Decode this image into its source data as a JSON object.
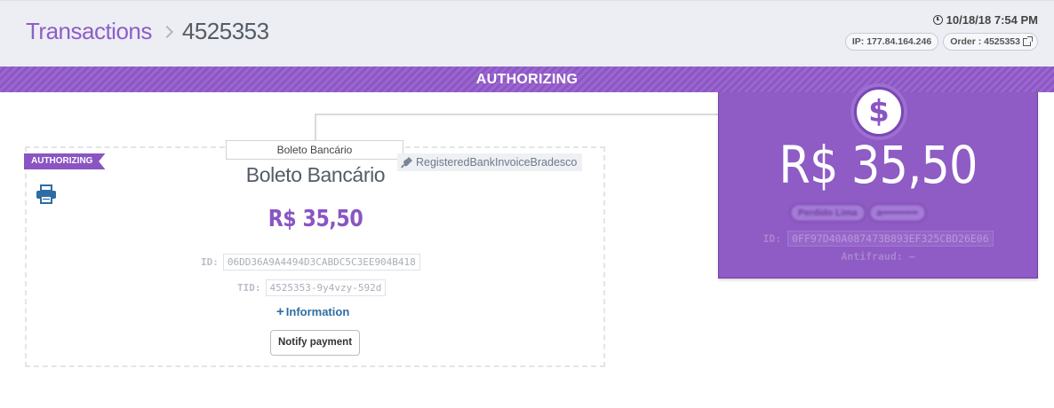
{
  "header": {
    "breadcrumb_root": "Transactions",
    "breadcrumb_current": "4525353",
    "datetime": "10/18/18 7:54 PM",
    "ip_label": "IP: 177.84.164.246",
    "order_label": "Order : 4525353"
  },
  "status_banner": "AUTHORIZING",
  "amount_card": {
    "amount": "R$ 35,50",
    "tags": [
      "Perdido Lima",
      "a•••••••••••"
    ],
    "id_label": "ID:",
    "id_value": "0FF97D40A087473B893EF325CBD26E06",
    "antifraud_label": "Antifraud:",
    "antifraud_value": "–"
  },
  "payment": {
    "method_label": "Boleto Bancário",
    "status_ribbon": "AUTHORIZING",
    "title": "Boleto Bancário",
    "gateway": "RegisteredBankInvoiceBradesco",
    "amount": "R$ 35,50",
    "id_label": "ID:",
    "id_value": "06DD36A9A4494D3CABDC5C3EE904B418",
    "tid_label": "TID:",
    "tid_value": "4525353-9y4vzy-592d",
    "info_link": "Information",
    "notify_button": "Notify payment"
  },
  "icons": {
    "clock": "clock-icon",
    "external": "external-link-icon",
    "dollar": "dollar-icon",
    "printer": "printer-icon",
    "plug": "plug-icon",
    "plus": "plus-icon"
  },
  "colors": {
    "accent": "#8a55c2",
    "link": "#2e6da4",
    "header_bg": "#eceef4"
  }
}
